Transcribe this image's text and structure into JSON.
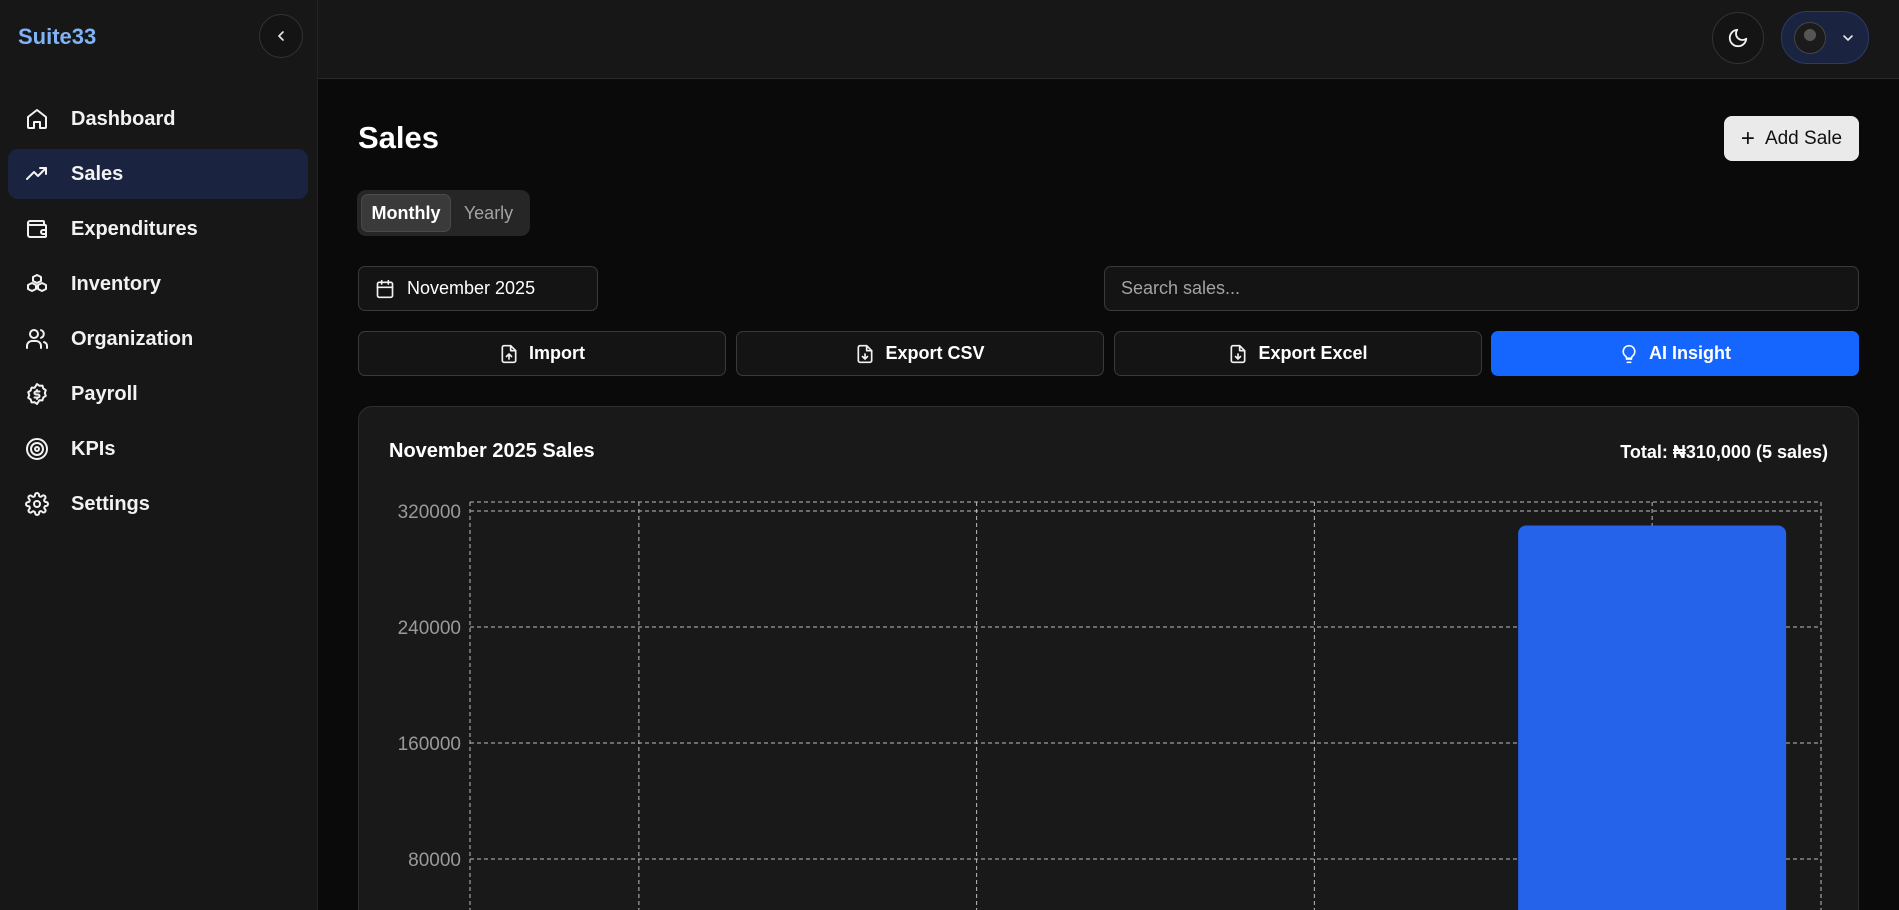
{
  "brand": "Suite33",
  "sidebar": {
    "items": [
      {
        "label": "Dashboard",
        "icon": "home-icon"
      },
      {
        "label": "Sales",
        "icon": "trending-up-icon",
        "active": true
      },
      {
        "label": "Expenditures",
        "icon": "wallet-icon"
      },
      {
        "label": "Inventory",
        "icon": "boxes-icon"
      },
      {
        "label": "Organization",
        "icon": "users-icon"
      },
      {
        "label": "Payroll",
        "icon": "dollar-badge-icon"
      },
      {
        "label": "KPIs",
        "icon": "target-icon"
      },
      {
        "label": "Settings",
        "icon": "gear-icon"
      }
    ]
  },
  "page": {
    "title": "Sales",
    "add_label": "Add Sale",
    "tabs": [
      "Monthly",
      "Yearly"
    ],
    "active_tab": "Monthly",
    "date_value": "November 2025",
    "search_placeholder": "Search sales...",
    "actions": {
      "import": "Import",
      "export_csv": "Export CSV",
      "export_excel": "Export Excel",
      "ai_insight": "AI Insight"
    }
  },
  "colors": {
    "accent": "#1566ff",
    "bar": "#2563eb",
    "brand": "#7fb3f5"
  },
  "chart_data": {
    "type": "bar",
    "title": "November 2025 Sales",
    "total_text": "Total: ₦310,000 (5 sales)",
    "categories": [
      "",
      "",
      "",
      ""
    ],
    "values": [
      0,
      0,
      0,
      310000
    ],
    "yticks": [
      "320000",
      "240000",
      "160000",
      "80000"
    ],
    "ylim": [
      0,
      320000
    ],
    "grid": true
  }
}
